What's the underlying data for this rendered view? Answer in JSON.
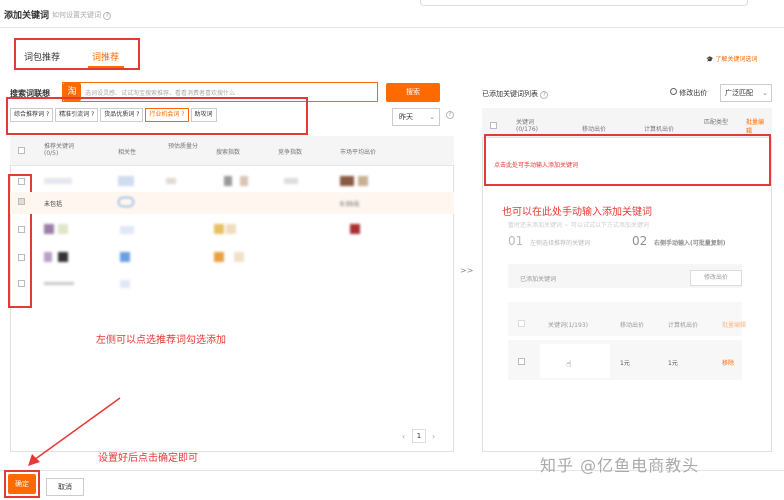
{
  "dialog": {
    "title": "添加关键词",
    "subtitle": "如何设置关键词"
  },
  "tabs": [
    {
      "label": "词包推荐"
    },
    {
      "label": "词推荐"
    }
  ],
  "learn_link": "了解关键词选词",
  "search": {
    "label": "搜索词联想",
    "logo": "淘",
    "placeholder": "选词设灵感、试试淘宝搜索推荐、看看消费者喜欢搜什么",
    "button": "搜索"
  },
  "filter_chips": [
    {
      "label": "综合推荐词",
      "help": "?"
    },
    {
      "label": "精准引流词",
      "help": "?"
    },
    {
      "label": "货品优质词",
      "help": "?"
    },
    {
      "label": "行业机会词",
      "help": "?"
    },
    {
      "label": "助攻词",
      "help": ""
    }
  ],
  "date_select": "昨天",
  "left_table": {
    "headers": [
      "推荐关键词",
      "相关性",
      "预估质量分",
      "搜索指数",
      "竞争指数",
      "市场平均出价"
    ],
    "count": "(0/5)",
    "partial_row_text": "未包括",
    "partial_row_value": "0.55元"
  },
  "pagination": {
    "page": "1"
  },
  "transfer_arrow": ">>",
  "right_panel": {
    "title": "已添加关键词列表",
    "price_label": "修改出价",
    "match_select": "广泛匹配",
    "headers": [
      "关键词",
      "移动出价",
      "计算机出价",
      "匹配类型"
    ],
    "count": "(0/176)",
    "batch_edit": "批量编辑",
    "manual_hint": "点击此处可手动输入添加关键词"
  },
  "annotations": {
    "right": "也可以在此处手动输入添加关键词",
    "left": "左侧可以点选推荐词勾选添加",
    "bottom": "设置好后点击确定即可"
  },
  "guide": {
    "hint": "暂时还未添加关键词 ~ 可以试试以下方式添加关键词",
    "step1_num": "01",
    "step1_text": "左侧选择推荐的关键词",
    "step2_num": "02",
    "step2_text": "右侧手动输入(可批量复制)",
    "inner_title": "已添加关键词",
    "inner_btn": "修改出价",
    "inner_headers": [
      "关键词(1/193)",
      "移动出价",
      "计算机出价",
      "批量编辑"
    ],
    "inner_row_price1": "1元",
    "inner_row_price2": "1元",
    "inner_row_action": "移除"
  },
  "footer": {
    "confirm": "确定",
    "cancel": "取消"
  },
  "watermark": "知乎 @亿鱼电商教头",
  "colors": {
    "accent": "#ff6a00",
    "annotation": "#e53935"
  }
}
